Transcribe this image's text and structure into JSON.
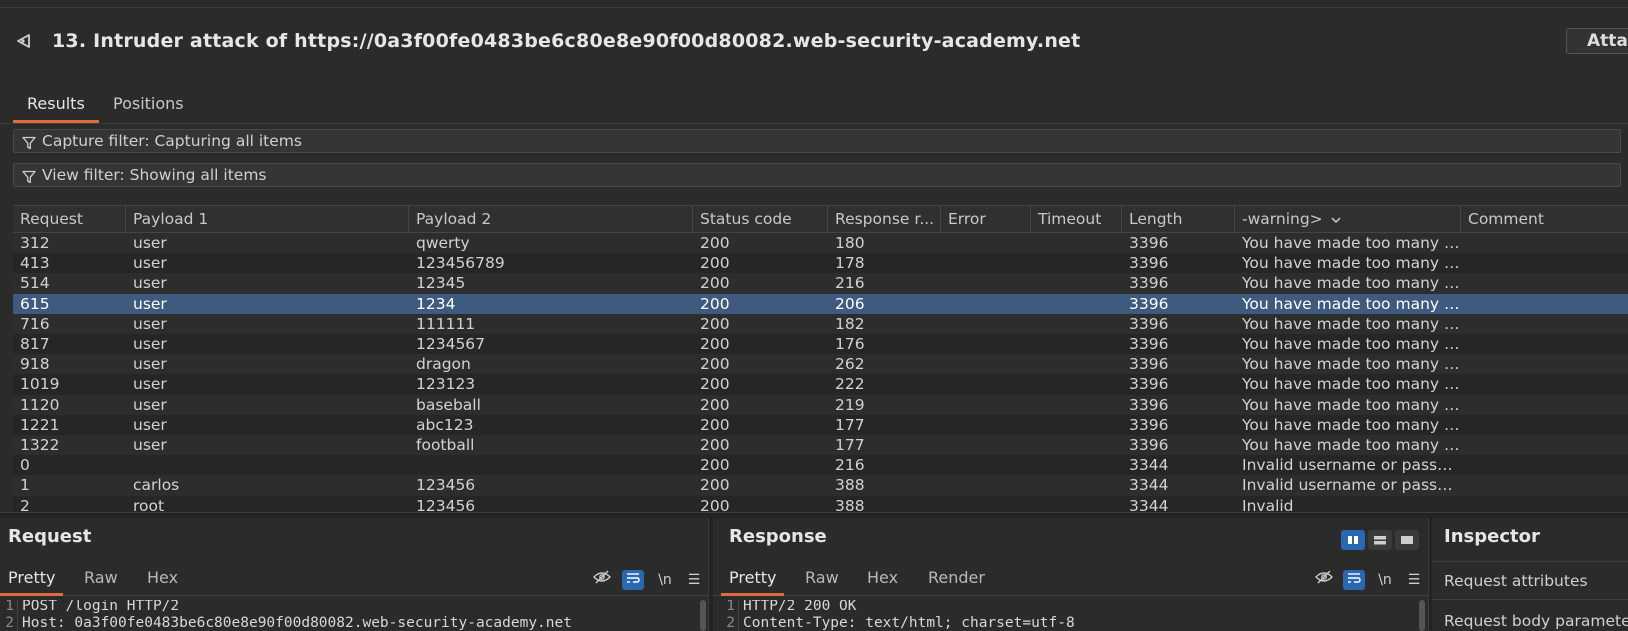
{
  "window": {
    "title": "13. Intruder attack of https://0a3f00fe0483be6c80e8e90f00d80082.web-security-academy.net",
    "attack_button": "Attack"
  },
  "tabs": [
    {
      "label": "Results",
      "active": true
    },
    {
      "label": "Positions",
      "active": false
    }
  ],
  "filters": {
    "capture": "Capture filter: Capturing all items",
    "view": "View filter: Showing all items"
  },
  "table": {
    "columns": [
      "Request",
      "Payload 1",
      "Payload 2",
      "Status code",
      "Response r...",
      "Error",
      "Timeout",
      "Length",
      "-warning>",
      "Comment"
    ],
    "rows": [
      [
        "312",
        "user",
        "qwerty",
        "200",
        "180",
        "",
        "",
        "3396",
        "You have made too many i..."
      ],
      [
        "413",
        "user",
        "123456789",
        "200",
        "178",
        "",
        "",
        "3396",
        "You have made too many i..."
      ],
      [
        "514",
        "user",
        "12345",
        "200",
        "216",
        "",
        "",
        "3396",
        "You have made too many i..."
      ],
      [
        "615",
        "user",
        "1234",
        "200",
        "206",
        "",
        "",
        "3396",
        "You have made too many i..."
      ],
      [
        "716",
        "user",
        "111111",
        "200",
        "182",
        "",
        "",
        "3396",
        "You have made too many i..."
      ],
      [
        "817",
        "user",
        "1234567",
        "200",
        "176",
        "",
        "",
        "3396",
        "You have made too many i..."
      ],
      [
        "918",
        "user",
        "dragon",
        "200",
        "262",
        "",
        "",
        "3396",
        "You have made too many i..."
      ],
      [
        "1019",
        "user",
        "123123",
        "200",
        "222",
        "",
        "",
        "3396",
        "You have made too many i..."
      ],
      [
        "1120",
        "user",
        "baseball",
        "200",
        "219",
        "",
        "",
        "3396",
        "You have made too many i..."
      ],
      [
        "1221",
        "user",
        "abc123",
        "200",
        "177",
        "",
        "",
        "3396",
        "You have made too many i..."
      ],
      [
        "1322",
        "user",
        "football",
        "200",
        "177",
        "",
        "",
        "3396",
        "You have made too many i..."
      ],
      [
        "0",
        "",
        "",
        "200",
        "216",
        "",
        "",
        "3344",
        "Invalid username or passw..."
      ],
      [
        "1",
        "carlos",
        "123456",
        "200",
        "388",
        "",
        "",
        "3344",
        "Invalid username or passw..."
      ],
      [
        "2",
        "root",
        "123456",
        "200",
        "388",
        "",
        "",
        "3344",
        "Invalid"
      ]
    ],
    "selected_row": 3
  },
  "request": {
    "title": "Request",
    "tabs": [
      "Pretty",
      "Raw",
      "Hex"
    ],
    "lines": [
      "POST /login HTTP/2",
      "Host: 0a3f00fe0483be6c80e8e90f00d80082.web-security-academy.net"
    ]
  },
  "response": {
    "title": "Response",
    "tabs": [
      "Pretty",
      "Raw",
      "Hex",
      "Render"
    ],
    "lines": [
      "HTTP/2 200 OK",
      "Content-Type: text/html; charset=utf-8"
    ]
  },
  "newline_label": "\\n",
  "inspector": {
    "title": "Inspector",
    "items": [
      "Request attributes",
      "Request body parameters"
    ]
  },
  "colors": {
    "accent": "#e06b3f",
    "selection": "#3e5a7e",
    "toggle_on": "#2a68b1"
  }
}
